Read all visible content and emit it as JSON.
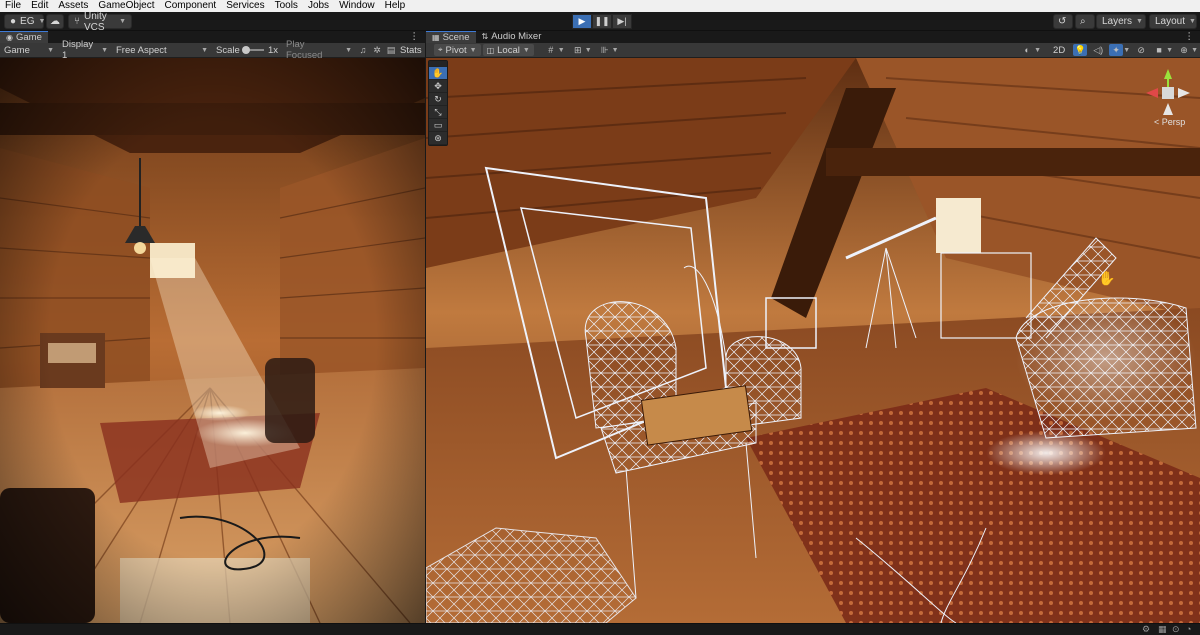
{
  "menu": [
    "File",
    "Edit",
    "Assets",
    "GameObject",
    "Component",
    "Services",
    "Tools",
    "Jobs",
    "Window",
    "Help"
  ],
  "toolbar": {
    "account": "EG",
    "vcs": "Unity VCS",
    "layers": "Layers",
    "layout": "Layout"
  },
  "game": {
    "tab": "Game",
    "mode": "Game",
    "display": "Display 1",
    "aspect": "Free Aspect",
    "scale_label": "Scale",
    "scale_value": "1x",
    "play_focused": "Play Focused",
    "stats": "Stats"
  },
  "scene": {
    "tabs": [
      "Scene",
      "Audio Mixer"
    ],
    "pivot": "Pivot",
    "local": "Local",
    "mode_2d": "2D",
    "persp": "< Persp"
  },
  "colors": {
    "accent": "#3b6fb4",
    "wood_light": "#c47a3e",
    "wood_dark": "#3a1d0c",
    "wireframe": "#e8ecf5"
  }
}
